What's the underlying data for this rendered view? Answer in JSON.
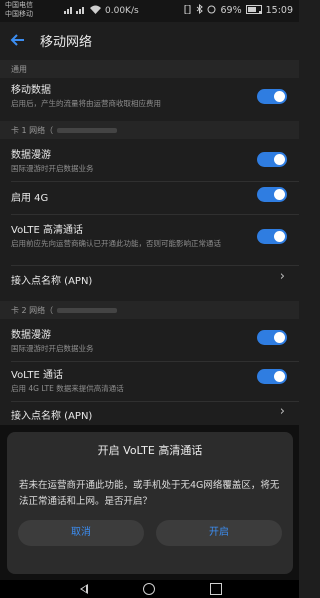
{
  "status": {
    "carrier1": "中国电信",
    "carrier2": "中国移动",
    "speed": "0.00K/s",
    "battery": "69%",
    "battery_level": 0.69,
    "time": "15:09"
  },
  "appbar": {
    "title": "移动网络"
  },
  "general": {
    "header": "通用",
    "mobile_data": {
      "title": "移动数据",
      "sub": "启用后，产生的流量将由运营商收取相应费用",
      "on": true
    }
  },
  "sim1": {
    "header": "卡 1 网络（",
    "roaming": {
      "title": "数据漫游",
      "sub": "国际漫游时开启数据业务",
      "on": true
    },
    "enable4g": {
      "title": "启用 4G",
      "on": true
    },
    "volte": {
      "title": "VoLTE 高清通话",
      "sub": "启用前应先向运营商确认已开通此功能，否则可能影响正常通话",
      "on": true
    },
    "apn": {
      "title": "接入点名称 (APN)"
    }
  },
  "sim2": {
    "header": "卡 2 网络（",
    "roaming": {
      "title": "数据漫游",
      "sub": "国际漫游时开启数据业务",
      "on": true
    },
    "volte": {
      "title": "VoLTE 通话",
      "sub": "启用 4G LTE 数据来提供高清通话",
      "on": true
    },
    "apn": {
      "title": "接入点名称 (APN)"
    }
  },
  "dialog": {
    "title": "开启 VoLTE 高清通话",
    "message": "若未在运营商开通此功能，或手机处于无4G网络覆盖区，将无法正常通话和上网。是否开启？",
    "cancel": "取消",
    "confirm": "开启"
  },
  "icons": [
    "signal-icon",
    "wifi-icon",
    "vibrate-icon",
    "bluetooth-icon",
    "alarm-icon",
    "battery-icon",
    "back-arrow-icon",
    "chevron-right-icon",
    "nav-back-icon",
    "nav-home-icon",
    "nav-recent-icon"
  ],
  "colors": {
    "accent": "#2f7de1",
    "background": "#1e1e1e",
    "dialog": "#2c2c2c"
  }
}
